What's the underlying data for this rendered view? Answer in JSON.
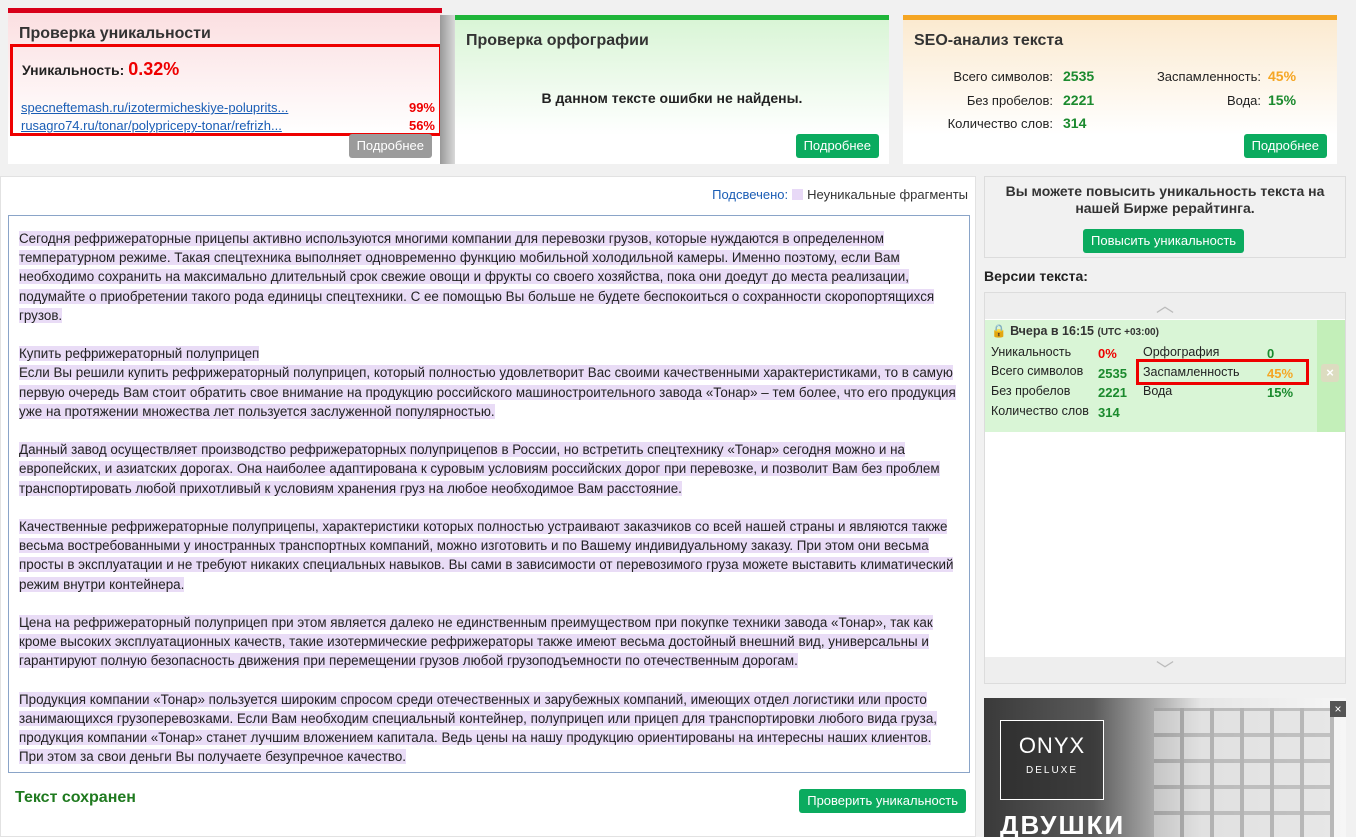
{
  "uniqueness": {
    "title": "Проверка уникальности",
    "label": "Уникальность:",
    "value": "0.32%",
    "sources": [
      {
        "url": "specneftemash.ru/izotermicheskiye-poluprits...",
        "pct": "99%"
      },
      {
        "url": "rusagro74.ru/tonar/polypricepy-tonar/refrizh...",
        "pct": "56%"
      }
    ],
    "more_label": "Подробнее"
  },
  "spelling": {
    "title": "Проверка орфографии",
    "message": "В данном тексте ошибки не найдены.",
    "more_label": "Подробнее"
  },
  "seo": {
    "title": "SEO-анализ текста",
    "chars_label": "Всего символов:",
    "chars": "2535",
    "nospace_label": "Без пробелов:",
    "nospace": "2221",
    "words_label": "Количество слов:",
    "words": "314",
    "spam_label": "Заспамленность:",
    "spam": "45%",
    "water_label": "Вода:",
    "water": "15%",
    "more_label": "Подробнее",
    "colors": {
      "good": "#1b8a2e",
      "warn": "#f5a623"
    }
  },
  "editor": {
    "legend_label": "Подсвечено:",
    "legend_item": "Неуникальные фрагменты",
    "highlight_color": "#e9dcf6",
    "paragraphs": [
      "Сегодня рефрижераторные прицепы активно используются многими компании для перевозки грузов, которые нуждаются в определенном температурном режиме. Такая спецтехника выполняет одновременно функцию мобильной холодильной камеры. Именно поэтому, если Вам необходимо сохранить на максимально длительный срок свежие овощи и фрукты со своего хозяйства, пока они доедут до места реализации, подумайте о приобретении такого рода единицы спецтехники. С ее помощью Вы больше не будете беспокоиться о сохранности скоропортящихся грузов.",
      "Купить рефрижераторный полуприцеп\nЕсли Вы решили купить рефрижераторный полуприцеп, который полностью удовлетворит Вас своими качественными характеристиками, то в самую первую очередь Вам стоит обратить свое внимание на продукцию российского машиностроительного завода «Тонар» – тем более, что его продукция уже на протяжении множества лет пользуется заслуженной популярностью.",
      "Данный завод осуществляет производство рефрижераторных полуприцепов в России, но встретить спецтехнику «Тонар» сегодня можно и на европейских, и азиатских дорогах. Она наиболее адаптирована к суровым условиям российских дорог при перевозке, и позволит Вам без проблем транспортировать любой прихотливый к условиям хранения груз на любое необходимое Вам расстояние.",
      "Качественные рефрижераторные полуприцепы, характеристики которых полностью устраивают заказчиков со всей нашей страны и являются также весьма востребованными у иностранных транспортных компаний, можно изготовить и по Вашему индивидуальному заказу. При этом они весьма просты в эксплуатации и не требуют никаких специальных навыков. Вы сами в зависимости от перевозимого груза можете выставить климатический режим внутри контейнера.",
      "Цена на рефрижераторный полуприцеп при этом является далеко не единственным преимуществом при покупке техники завода «Тонар», так как кроме высоких эксплуатационных качеств, такие изотермические рефрижераторы также имеют весьма достойный внешний вид, универсальны и гарантируют полную безопасность движения при перемещении грузов любой грузоподъемности по отечественным дорогам.",
      "Продукция компании «Тонар» пользуется широким спросом среди отечественных и зарубежных компаний, имеющих отдел логистики или просто занимающихся грузоперевозками. Если Вам необходим специальный контейнер, полуприцеп или прицеп для транспортировки любого вида груза, продукция компании «Тонар» станет лучшим вложением капитала. Ведь цены на нашу продукцию ориентированы на интересны наших клиентов. При этом за свои деньги Вы получаете безупречное качество."
    ],
    "saved_label": "Текст сохранен",
    "check_label": "Проверить уникальность"
  },
  "promo": {
    "text": "Вы можете повысить уникальность текста на нашей Бирже рерайтинга.",
    "button_label": "Повысить уникальность"
  },
  "versions": {
    "title": "Версии текста:",
    "up_icon": "chevron-up-icon",
    "down_icon": "chevron-down-icon",
    "items": [
      {
        "date": "Вчера в 16:15",
        "tz": "(UTC +03:00)",
        "uniq_label": "Уникальность",
        "uniq": "0%",
        "chars_label": "Всего символов",
        "chars": "2535",
        "nospace_label": "Без пробелов",
        "nospace": "2221",
        "words_label": "Количество слов",
        "words": "314",
        "spell_label": "Орфография",
        "spell": "0",
        "spam_label": "Заспамленность",
        "spam": "45%",
        "water_label": "Вода",
        "water": "15%"
      }
    ]
  },
  "ad": {
    "brand": "ONYX",
    "brand_sub": "DELUXE",
    "headline": "ДВУШКИ",
    "close": "×"
  }
}
